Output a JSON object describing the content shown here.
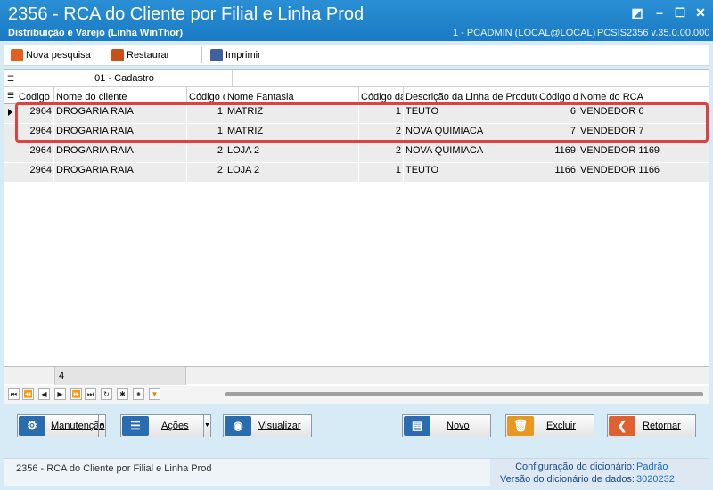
{
  "window": {
    "title": "2356 - RCA do Cliente por Filial e Linha Prod",
    "subtitle": "Distribuição e Varejo (Linha WinThor)",
    "user": "1 - PCADMIN (LOCAL@LOCAL)",
    "version": "PCSIS2356  v.35.0.00.000",
    "controls": [
      "restore-icon",
      "minimize-icon",
      "maximize-icon",
      "close-icon"
    ]
  },
  "toolbar": {
    "new_search": "Nova pesquisa",
    "restore": "Restaurar",
    "print": "Imprimir"
  },
  "grid": {
    "band_label": "01 - Cadastro",
    "columns": [
      "Código",
      "Nome do cliente",
      "Código d",
      "Nome Fantasia",
      "Código da",
      "Descrição da Linha de Produto",
      "Código d",
      "Nome do RCA"
    ],
    "rows": [
      [
        "2964",
        "DROGARIA RAIA",
        "1",
        "MATRIZ",
        "1",
        "TEUTO",
        "6",
        "VENDEDOR 6"
      ],
      [
        "2964",
        "DROGARIA RAIA",
        "1",
        "MATRIZ",
        "2",
        "NOVA QUIMIACA",
        "7",
        "VENDEDOR 7"
      ],
      [
        "2964",
        "DROGARIA RAIA",
        "2",
        "LOJA 2",
        "2",
        "NOVA QUIMIACA",
        "1169",
        "VENDEDOR 1169"
      ],
      [
        "2964",
        "DROGARIA RAIA",
        "2",
        "LOJA 2",
        "1",
        "TEUTO",
        "1166",
        "VENDEDOR 1166"
      ]
    ],
    "record_count": "4",
    "highlight_color": "#e04040"
  },
  "buttons": {
    "manutencao": "Manutenção",
    "acoes": "Ações",
    "visualizar": "Visualizar",
    "novo": "Novo",
    "excluir": "Excluir",
    "retornar": "Retornar"
  },
  "status": {
    "text": "2356 - RCA do Cliente por Filial e Linha Prod",
    "dict_config_label": "Configuração do dicionário:",
    "dict_config_value": "Padrão",
    "dict_version_label": "Versão do dicionário de dados:",
    "dict_version_value": "3020232"
  }
}
